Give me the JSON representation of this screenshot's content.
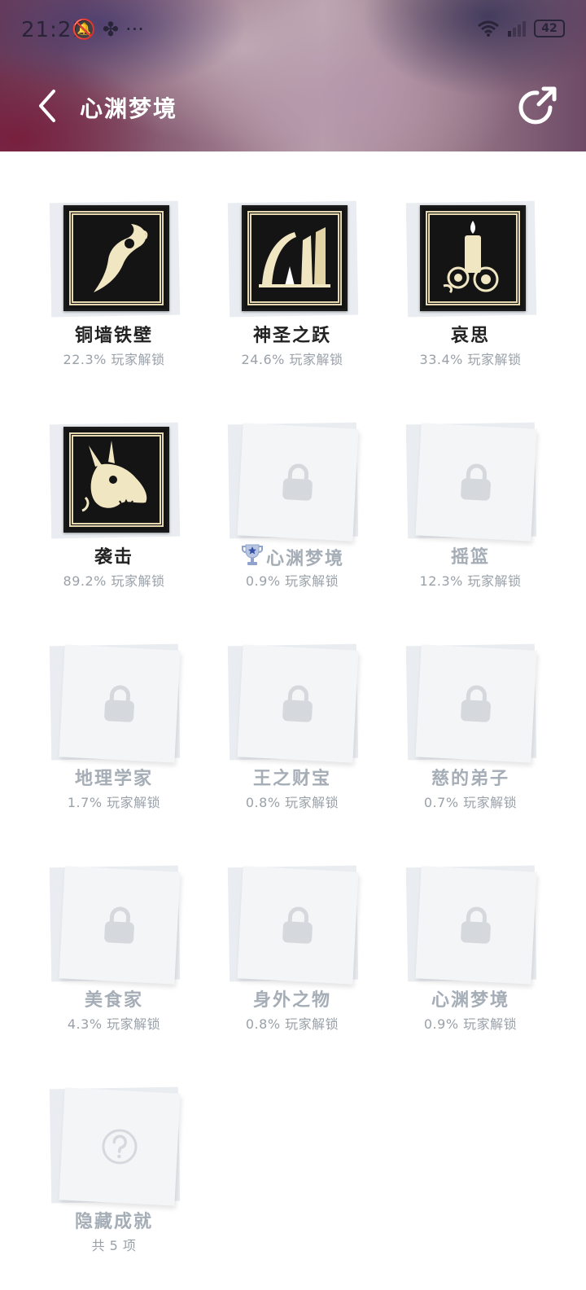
{
  "status_bar": {
    "time": "21:21",
    "icons_left": [
      "mute-icon",
      "pinwheel-icon",
      "more-dots-icon"
    ],
    "icons_right": [
      "wifi-icon",
      "signal-icon"
    ],
    "battery": "42"
  },
  "header": {
    "title": "心渊梦境",
    "back_icon": "chevron-left-icon",
    "share_icon": "share-icon"
  },
  "achievements": [
    {
      "name": "铜墙铁壁",
      "stat": "22.3% 玩家解锁",
      "locked": false,
      "icon": "dragon-claw-emblem"
    },
    {
      "name": "神圣之跃",
      "stat": "24.6% 玩家解锁",
      "locked": false,
      "icon": "arch-pillars-emblem"
    },
    {
      "name": "哀思",
      "stat": "33.4% 玩家解锁",
      "locked": false,
      "icon": "candle-roses-emblem"
    },
    {
      "name": "袭击",
      "stat": "89.2% 玩家解锁",
      "locked": false,
      "icon": "dragon-head-emblem"
    },
    {
      "name": "心渊梦境",
      "stat": "0.9% 玩家解锁",
      "locked": true,
      "icon": "lock-icon",
      "trophy": true
    },
    {
      "name": "摇篮",
      "stat": "12.3% 玩家解锁",
      "locked": true,
      "icon": "lock-icon"
    },
    {
      "name": "地理学家",
      "stat": "1.7% 玩家解锁",
      "locked": true,
      "icon": "lock-icon"
    },
    {
      "name": "王之财宝",
      "stat": "0.8% 玩家解锁",
      "locked": true,
      "icon": "lock-icon"
    },
    {
      "name": "慈的弟子",
      "stat": "0.7% 玩家解锁",
      "locked": true,
      "icon": "lock-icon"
    },
    {
      "name": "美食家",
      "stat": "4.3% 玩家解锁",
      "locked": true,
      "icon": "lock-icon"
    },
    {
      "name": "身外之物",
      "stat": "0.8% 玩家解锁",
      "locked": true,
      "icon": "lock-icon"
    },
    {
      "name": "心渊梦境",
      "stat": "0.9% 玩家解锁",
      "locked": true,
      "icon": "lock-icon"
    },
    {
      "name": "隐藏成就",
      "stat": "共 5 项",
      "locked": true,
      "icon": "question-icon"
    }
  ],
  "colors": {
    "card_bg": "#f3f5f7",
    "locked_text": "#a5adb6",
    "unlocked_text": "#222222",
    "badge_gold": "#e6d9b0"
  }
}
